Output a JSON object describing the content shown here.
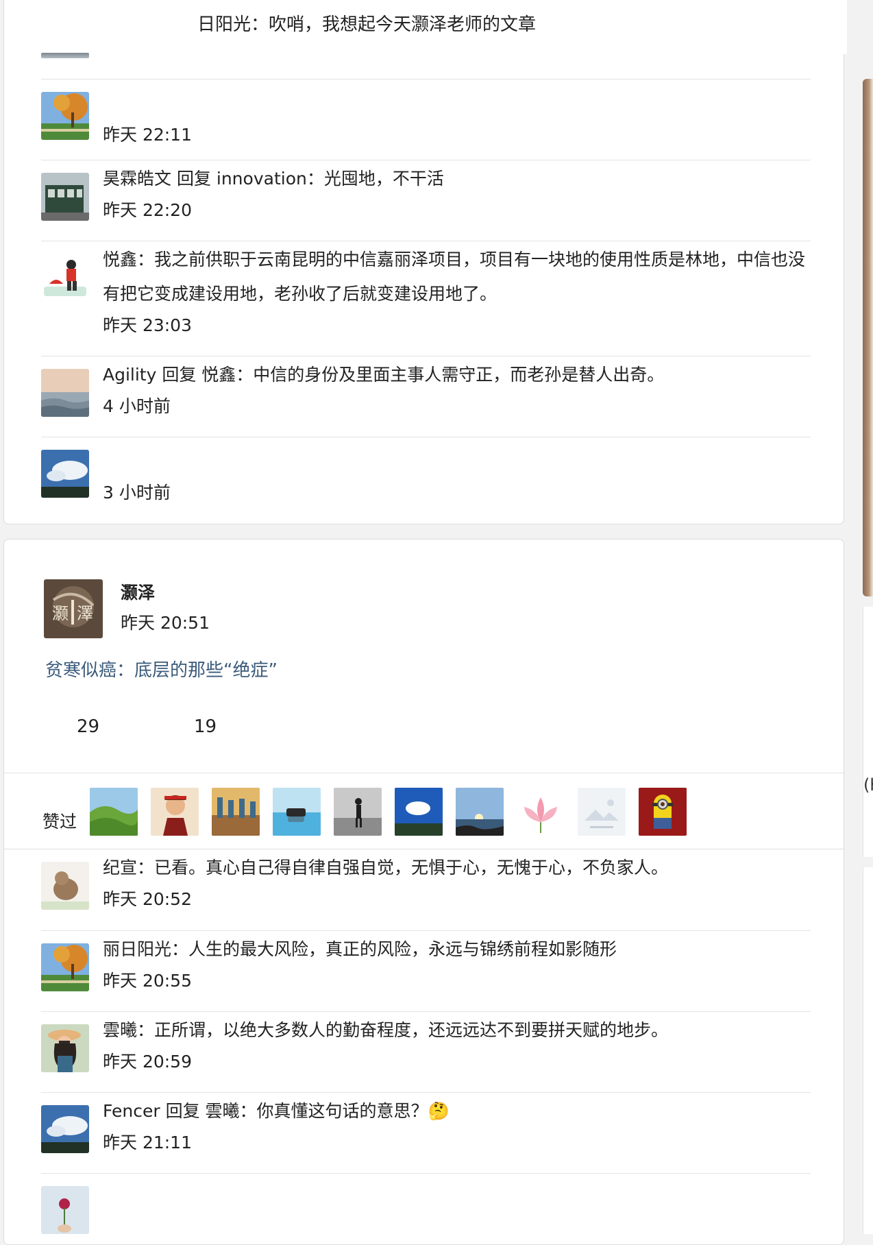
{
  "top_snippet": "日阳光：吹哨，我想起今天灏泽老师的文章",
  "thread1": [
    {
      "avatar": "autumn-tree-avatar",
      "text": "",
      "time": "昨天 22:11"
    },
    {
      "avatar": "tram-avatar",
      "text": "昊霖皓文 回复 innovation：光囤地，不干活",
      "time": "昨天 22:20"
    },
    {
      "avatar": "cartoon-girl-avatar",
      "text": "悦鑫：我之前供职于云南昆明的中信嘉丽泽项目，项目有一块地的使用性质是林地，中信也没有把它变成建设用地，老孙收了后就变建设用地了。",
      "time": "昨天 23:03"
    },
    {
      "avatar": "sea-sunset-avatar",
      "text": "Agility 回复 悦鑫：中信的身份及里面主事人需守正，而老孙是替人出奇。",
      "time": "4 小时前"
    },
    {
      "avatar": "sky-clouds-avatar",
      "text": "",
      "time": "3 小时前"
    }
  ],
  "post": {
    "author": "灏泽",
    "time": "昨天 20:51",
    "article_title": "贫寒似癌：底层的那些“绝症”",
    "stat_a": "29",
    "stat_b": "19",
    "likes_label": "赞过",
    "likers": [
      "green-hills-icon",
      "anime-warrior-icon",
      "painting-icon",
      "lake-car-icon",
      "runner-icon",
      "blue-sky-icon",
      "sunset-sea-icon",
      "lotus-icon",
      "placeholder-image-icon",
      "minion-icon"
    ]
  },
  "thread2": [
    {
      "avatar": "dog-avatar",
      "text": "纪宣：已看。真心自己得自律自强自觉，无惧于心，无愧于心，不负家人。",
      "time": "昨天 20:52"
    },
    {
      "avatar": "autumn-tree-avatar",
      "text": "丽日阳光：人生的最大风险，真正的风险，永远与锦绣前程如影随形",
      "time": "昨天 20:55"
    },
    {
      "avatar": "woman-hat-avatar",
      "text": "雲曦：正所谓，以绝大多数人的勤奋程度，还远远达不到要拼天赋的地步。",
      "time": "昨天 20:59"
    },
    {
      "avatar": "sky-clouds-avatar",
      "text": "Fencer 回复 雲曦：你真懂这句话的意思？🤔",
      "time": "昨天 21:11"
    },
    {
      "avatar": "rose-avatar",
      "text": "",
      "time": ""
    }
  ],
  "right_edge_text": "(h"
}
